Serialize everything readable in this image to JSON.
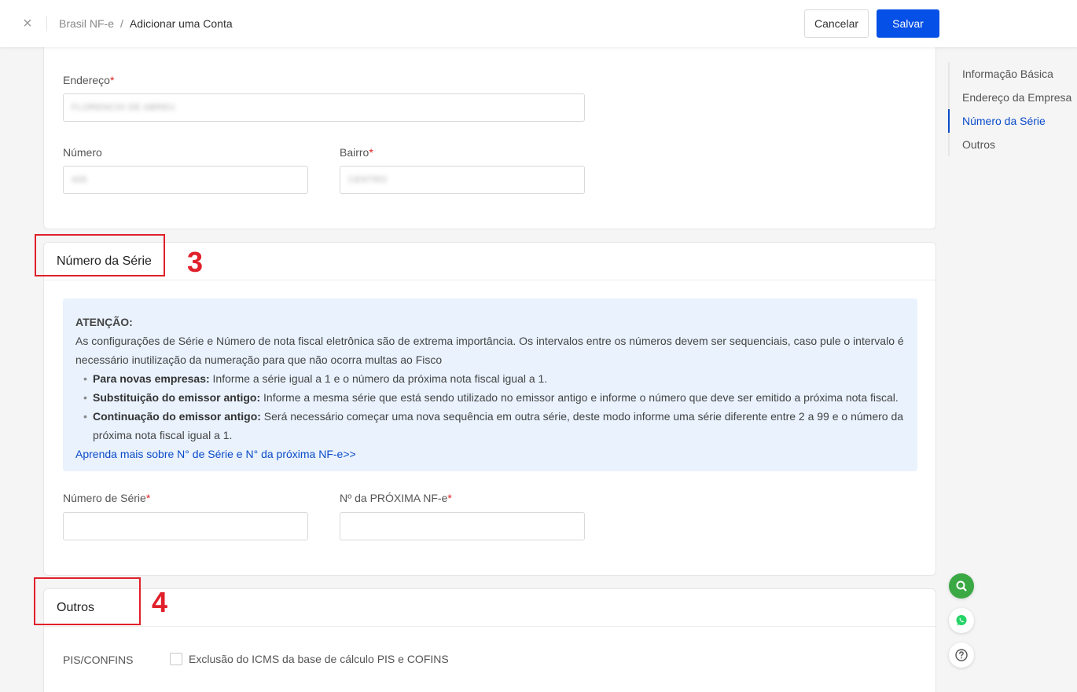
{
  "header": {
    "breadcrumb_root": "Brasil NF-e",
    "breadcrumb_sep": "/",
    "breadcrumb_current": "Adicionar uma Conta",
    "cancel_label": "Cancelar",
    "save_label": "Salvar",
    "close_glyph": "×"
  },
  "address_section": {
    "endereco_label": "Endereço",
    "endereco_value": "FLORENCIO DE ABREU",
    "numero_label": "Número",
    "numero_value": "406",
    "bairro_label": "Bairro",
    "bairro_value": "CENTRO",
    "required_mark": "*"
  },
  "serie_section": {
    "title": "Número da Série",
    "notice": {
      "title": "ATENÇÃO:",
      "intro": "As configurações de Série e Número de nota fiscal eletrônica são de extrema importância. Os intervalos entre os números devem ser sequenciais, caso pule o intervalo é necessário inutilização da numeração para que não ocorra multas ao Fisco",
      "items": [
        {
          "bold": "Para novas empresas:",
          "text": " Informe a série igual a 1 e o número da próxima nota fiscal igual a 1."
        },
        {
          "bold": "Substituição do emissor antigo:",
          "text": " Informe a mesma série que está sendo utilizado no emissor antigo e informe o número que deve ser emitido a próxima nota fiscal."
        },
        {
          "bold": "Continuação do emissor antigo:",
          "text": " Será necessário começar uma nova sequência em outra série, deste modo informe uma série diferente entre 2 a 99 e o número da próxima nota fiscal igual a 1."
        }
      ],
      "link": "Aprenda mais sobre N° de Série e N° da próxima NF-e>>"
    },
    "numero_serie_label": "Número de Série",
    "proxima_label": "Nº da PRÓXIMA NF-e",
    "annotation": "3"
  },
  "outros_section": {
    "title": "Outros",
    "pis_label": "PIS/CONFINS",
    "checkbox_label": "Exclusão do ICMS da base de cálculo PIS e COFINS",
    "annotation": "4"
  },
  "side_nav": {
    "items": [
      {
        "label": "Informação Básica"
      },
      {
        "label": "Endereço da Empresa"
      },
      {
        "label": "Número da Série"
      },
      {
        "label": "Outros"
      }
    ]
  },
  "colors": {
    "primary": "#0550e6",
    "annotation": "#e0202a",
    "notice_bg": "#e9f2fd",
    "fab_green": "#3aa843",
    "whatsapp": "#25d366"
  },
  "icons": [
    "close-icon",
    "search-icon",
    "whatsapp-icon",
    "help-icon"
  ]
}
